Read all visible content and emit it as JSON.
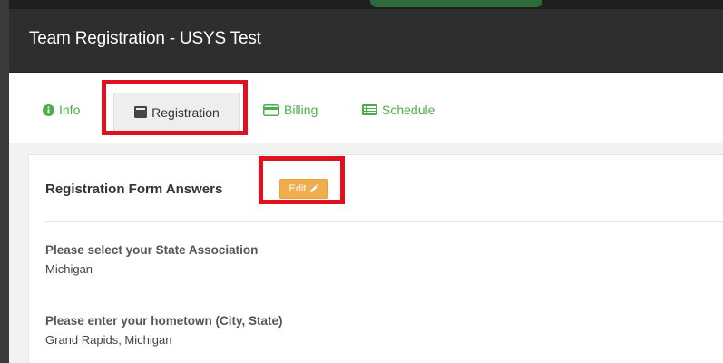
{
  "window": {
    "title": "Team Registration - USYS Test"
  },
  "tabs": [
    {
      "label": "Info",
      "icon": "info-circle-icon",
      "active": false
    },
    {
      "label": "Registration",
      "icon": "list-alt-icon",
      "active": true
    },
    {
      "label": "Billing",
      "icon": "credit-card-icon",
      "active": false
    },
    {
      "label": "Schedule",
      "icon": "table-list-icon",
      "active": false
    }
  ],
  "panel": {
    "title": "Registration Form Answers",
    "edit_label": "Edit",
    "items": [
      {
        "question": "Please select your State Association",
        "answer": "Michigan"
      },
      {
        "question": "Please enter your hometown (City, State)",
        "answer": "Grand Rapids, Michigan"
      }
    ]
  },
  "colors": {
    "header_bg": "#2e2e2e",
    "tab_green": "#4cae4c",
    "edit_button": "#f0ad4e",
    "highlight_red": "#e0101e"
  }
}
